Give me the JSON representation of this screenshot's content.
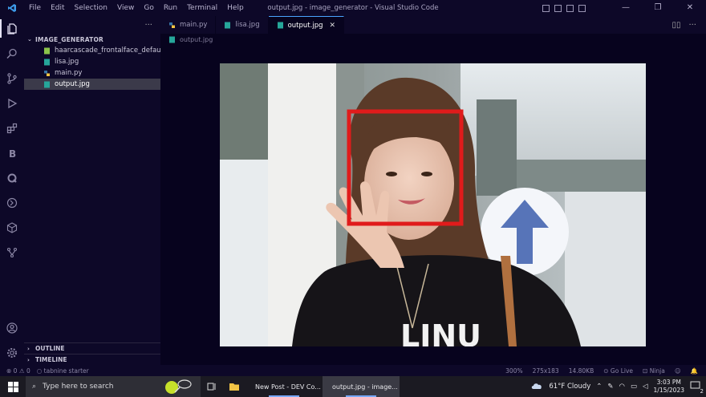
{
  "titlebar": {
    "menus": [
      "File",
      "Edit",
      "Selection",
      "View",
      "Go",
      "Run",
      "Terminal",
      "Help"
    ],
    "title": "output.jpg - image_generator - Visual Studio Code"
  },
  "explorer": {
    "folder": "IMAGE_GENERATOR",
    "files": [
      {
        "name": "haarcascade_frontalface_default.x...",
        "icon": "xml-file-icon"
      },
      {
        "name": "lisa.jpg",
        "icon": "image-file-icon"
      },
      {
        "name": "main.py",
        "icon": "python-file-icon"
      },
      {
        "name": "output.jpg",
        "icon": "image-file-icon"
      }
    ],
    "outline": "OUTLINE",
    "timeline": "TIMELINE"
  },
  "tabs": [
    {
      "label": "main.py",
      "icon": "python-file-icon"
    },
    {
      "label": "lisa.jpg",
      "icon": "image-file-icon"
    },
    {
      "label": "output.jpg",
      "icon": "image-file-icon",
      "active": true
    }
  ],
  "breadcrumb": "output.jpg",
  "statusbar": {
    "errors": "0",
    "warnings": "0",
    "tabnine": "tabnine starter",
    "zoom": "300%",
    "dimensions": "275x183",
    "filesize": "14.80KB",
    "golive": "Go Live",
    "ninja": "Ninja"
  },
  "taskbar": {
    "search_placeholder": "Type here to search",
    "apps": [
      {
        "label": "New Post - DEV Co..."
      },
      {
        "label": "output.jpg - image..."
      }
    ],
    "weather": "61°F  Cloudy",
    "time": "3:03 PM",
    "date": "1/15/2023",
    "notifications": "2"
  },
  "colors": {
    "accent": "#4aa3ff",
    "face_box": "#e01b1b"
  }
}
